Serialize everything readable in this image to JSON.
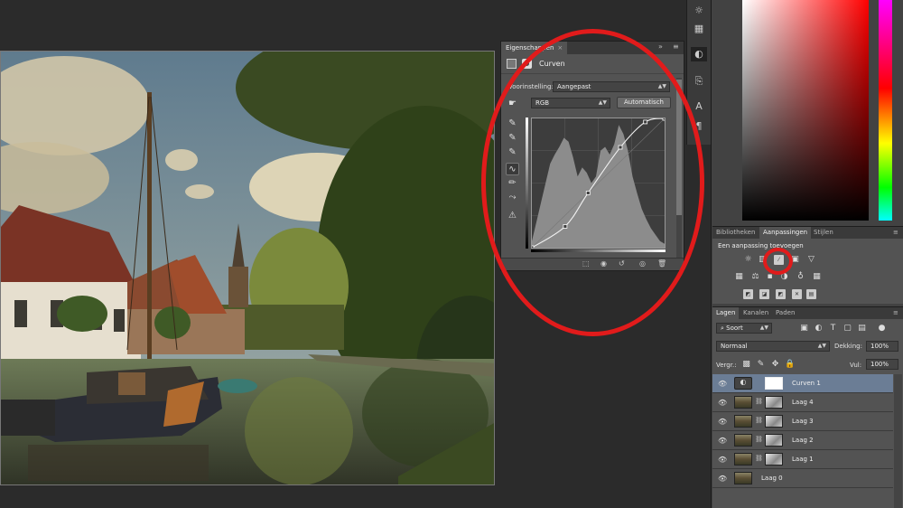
{
  "properties_panel": {
    "tab_label": "Eigenschappen",
    "tab_close": "×",
    "expand_icon": "»",
    "menu_icon": "≡",
    "header_title": "Curven",
    "preset_label": "Voorinstelling:",
    "preset_value": "Aangepast",
    "channel_value": "RGB",
    "auto_button": "Automatisch",
    "tools": [
      "eyedropper-target-icon",
      "eyedropper-black-icon",
      "eyedropper-gray-icon",
      "eyedropper-white-icon",
      "curve-tool-icon",
      "pencil-icon",
      "smooth-icon",
      "clipping-warning-icon"
    ],
    "footer_icons": [
      "clip-to-layer-icon",
      "view-previous-icon",
      "reset-icon",
      "visibility-icon",
      "delete-icon"
    ]
  },
  "curves_data": {
    "type": "line",
    "x": [
      0,
      64,
      108,
      170,
      218,
      255
    ],
    "y": [
      0,
      42,
      108,
      198,
      248,
      255
    ],
    "xlim": [
      0,
      255
    ],
    "ylim": [
      0,
      255
    ],
    "histogram": [
      0.05,
      0.2,
      0.35,
      0.5,
      0.65,
      0.72,
      0.78,
      0.85,
      0.82,
      0.7,
      0.55,
      0.62,
      0.58,
      0.5,
      0.55,
      0.75,
      0.78,
      0.72,
      0.8,
      0.95,
      0.88,
      0.75,
      0.55,
      0.42,
      0.3,
      0.22,
      0.15,
      0.1,
      0.05,
      0.03
    ]
  },
  "adjustments_panel": {
    "tabs": [
      "Bibliotheken",
      "Aanpassingen",
      "Stijlen"
    ],
    "active_tab": "Aanpassingen",
    "hint": "Een aanpassing toevoegen"
  },
  "layers_panel": {
    "tabs": [
      "Lagen",
      "Kanalen",
      "Paden"
    ],
    "active_tab": "Lagen",
    "filter_value": "Soort",
    "blend_mode": "Normaal",
    "opacity_label": "Dekking:",
    "opacity_value": "100%",
    "lock_label": "Vergr.:",
    "fill_label": "Vul:",
    "fill_value": "100%",
    "layers": [
      {
        "name": "Curven 1",
        "selected": true,
        "kind": "adjustment"
      },
      {
        "name": "Laag 4",
        "selected": false,
        "kind": "masked"
      },
      {
        "name": "Laag 3",
        "selected": false,
        "kind": "masked"
      },
      {
        "name": "Laag 2",
        "selected": false,
        "kind": "masked"
      },
      {
        "name": "Laag 1",
        "selected": false,
        "kind": "masked"
      },
      {
        "name": "Laag 0",
        "selected": false,
        "kind": "image"
      }
    ]
  },
  "colors": {
    "annotation_red": "#e11b1b",
    "selected_layer": "#6b7d95",
    "panel_bg": "#535353",
    "workspace_bg": "#2b2b2b"
  }
}
